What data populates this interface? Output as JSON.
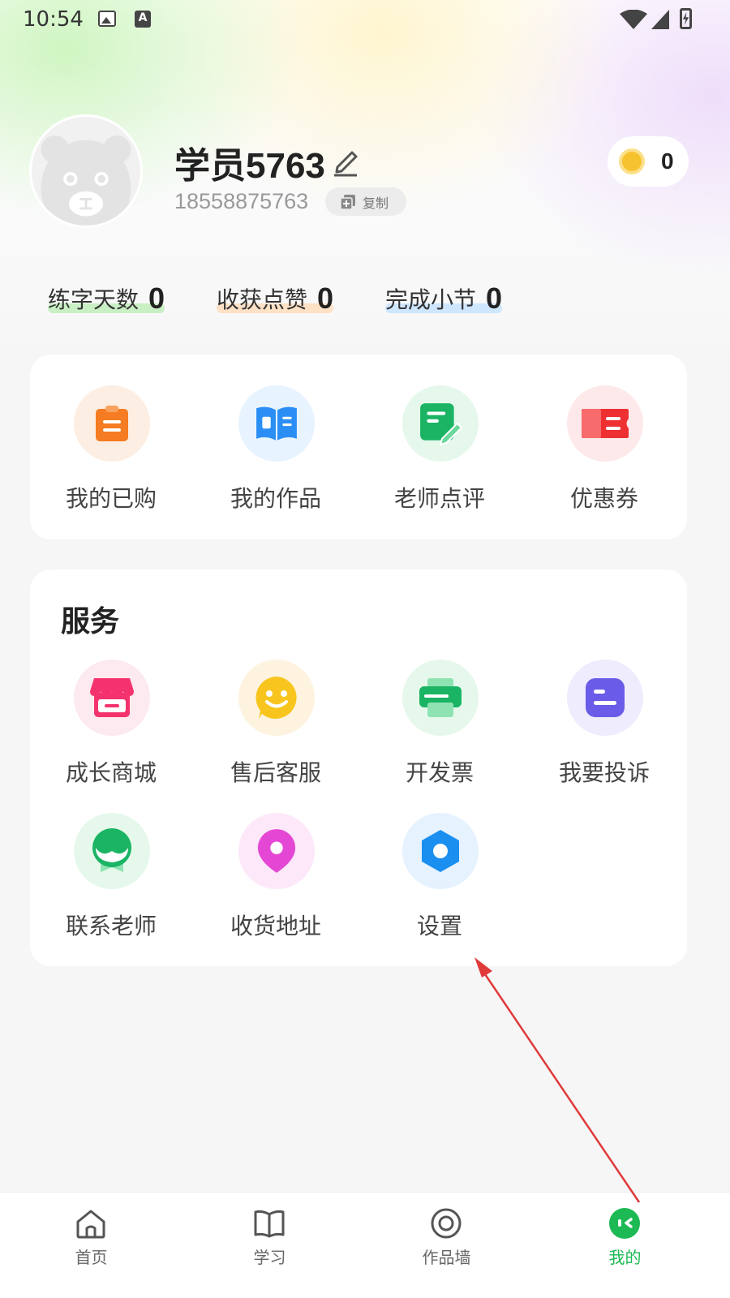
{
  "status_bar": {
    "time": "10:54",
    "a_badge": "A"
  },
  "profile": {
    "name": "学员5763",
    "phone": "18558875763",
    "copy_label": "复制",
    "coins": "0"
  },
  "stats": [
    {
      "label": "练字天数",
      "value": "0",
      "color": "#c9f0c4"
    },
    {
      "label": "收获点赞",
      "value": "0",
      "color": "#ffe1c6"
    },
    {
      "label": "完成小节",
      "value": "0",
      "color": "#cfe6ff"
    }
  ],
  "main_menu": [
    {
      "label": "我的已购",
      "icon": "clipboard-icon"
    },
    {
      "label": "我的作品",
      "icon": "book-icon"
    },
    {
      "label": "老师点评",
      "icon": "note-edit-icon"
    },
    {
      "label": "优惠券",
      "icon": "coupon-icon"
    }
  ],
  "services": {
    "title": "服务",
    "items": [
      {
        "label": "成长商城",
        "icon": "shop-icon"
      },
      {
        "label": "售后客服",
        "icon": "smiley-chat-icon"
      },
      {
        "label": "开发票",
        "icon": "printer-icon"
      },
      {
        "label": "我要投诉",
        "icon": "complaint-icon"
      },
      {
        "label": "联系老师",
        "icon": "teacher-icon"
      },
      {
        "label": "收货地址",
        "icon": "location-pin-icon"
      },
      {
        "label": "设置",
        "icon": "settings-hex-icon"
      }
    ]
  },
  "tabs": [
    {
      "label": "首页",
      "icon": "home-icon"
    },
    {
      "label": "学习",
      "icon": "open-book-icon"
    },
    {
      "label": "作品墙",
      "icon": "target-icon"
    },
    {
      "label": "我的",
      "icon": "profile-face-icon",
      "active": true
    }
  ],
  "colors": {
    "accent": "#1db954",
    "annotation": "#e03a3a"
  }
}
